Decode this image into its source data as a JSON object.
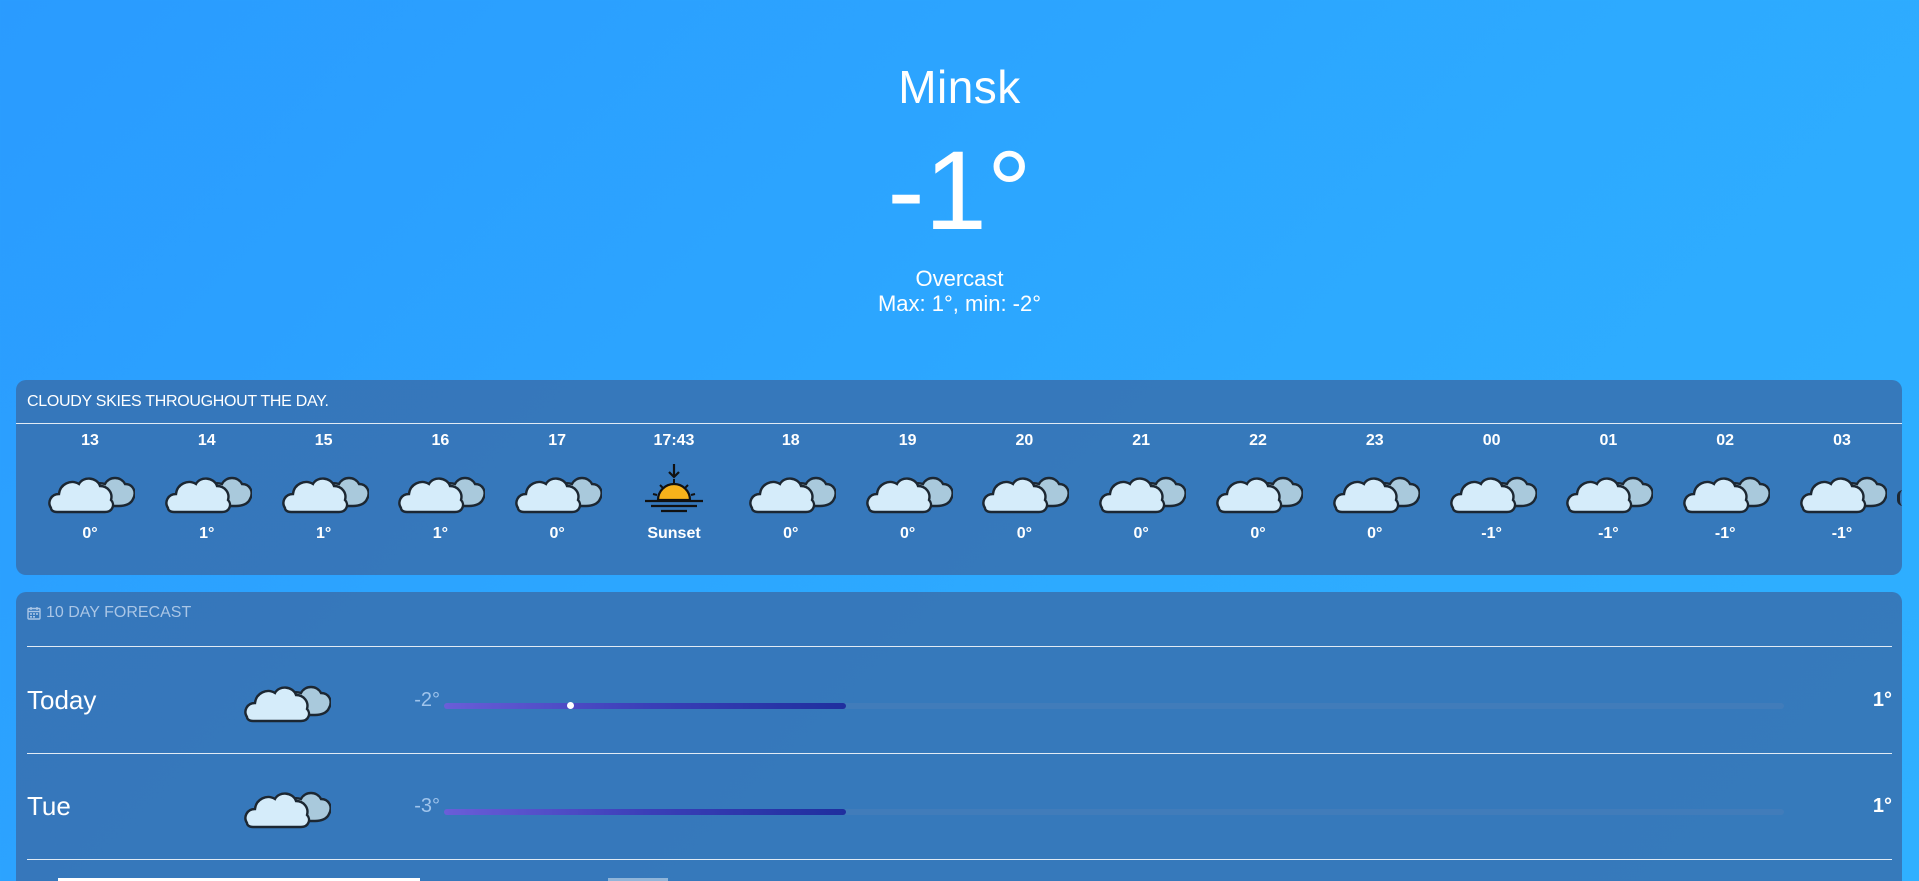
{
  "current": {
    "city": "Minsk",
    "temp": "-1°",
    "condition": "Overcast",
    "maxmin": "Max: 1°, min: -2°"
  },
  "hourly": {
    "summary": "CLOUDY SKIES THROUGHOUT THE DAY.",
    "items": [
      {
        "time": "13",
        "icon": "cloudy-icon",
        "temp": "0°"
      },
      {
        "time": "14",
        "icon": "cloudy-icon",
        "temp": "1°"
      },
      {
        "time": "15",
        "icon": "cloudy-icon",
        "temp": "1°"
      },
      {
        "time": "16",
        "icon": "cloudy-icon",
        "temp": "1°"
      },
      {
        "time": "17",
        "icon": "cloudy-icon",
        "temp": "0°"
      },
      {
        "time": "17:43",
        "icon": "sunset-icon",
        "temp": "Sunset"
      },
      {
        "time": "18",
        "icon": "cloudy-icon",
        "temp": "0°"
      },
      {
        "time": "19",
        "icon": "cloudy-icon",
        "temp": "0°"
      },
      {
        "time": "20",
        "icon": "cloudy-icon",
        "temp": "0°"
      },
      {
        "time": "21",
        "icon": "cloudy-icon",
        "temp": "0°"
      },
      {
        "time": "22",
        "icon": "cloudy-icon",
        "temp": "0°"
      },
      {
        "time": "23",
        "icon": "cloudy-icon",
        "temp": "0°"
      },
      {
        "time": "00",
        "icon": "cloudy-icon",
        "temp": "-1°"
      },
      {
        "time": "01",
        "icon": "cloudy-icon",
        "temp": "-1°"
      },
      {
        "time": "02",
        "icon": "cloudy-icon",
        "temp": "-1°"
      },
      {
        "time": "03",
        "icon": "cloudy-icon",
        "temp": "-1°"
      }
    ]
  },
  "daily": {
    "header": "10 DAY FORECAST",
    "header_icon": "calendar-icon",
    "days": [
      {
        "name": "Today",
        "icon": "cloudy-icon",
        "min": "-2°",
        "max": "1°",
        "range_start": 0.0,
        "range_end": 0.3,
        "current_pos": 0.095
      },
      {
        "name": "Tue",
        "icon": "cloudy-icon",
        "min": "-3°",
        "max": "1°",
        "range_start": 0.0,
        "range_end": 0.3,
        "current_pos": null
      }
    ]
  },
  "colors": {
    "background": "#2aa4ff",
    "panel": "#386eac",
    "bar_start": "#6a5ed8",
    "bar_end": "#1f2f9e",
    "sun": "#f7b21b"
  }
}
